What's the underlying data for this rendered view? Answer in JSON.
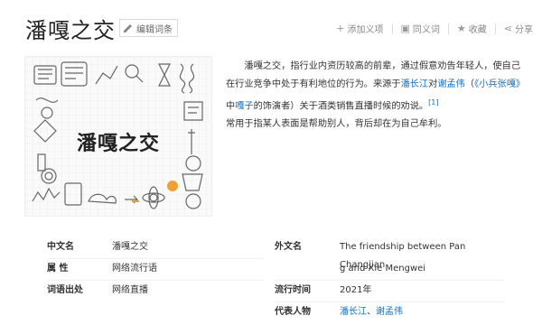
{
  "header": {
    "title": "潘嘎之交",
    "edit_label": "编辑词条",
    "actions": [
      {
        "icon": "plus",
        "label": "添加义项"
      },
      {
        "icon": "book",
        "label": "同义词"
      },
      {
        "icon": "star",
        "label": "收藏"
      },
      {
        "icon": "share",
        "label": "分享"
      }
    ]
  },
  "summary_image": {
    "caption": "潘嘎之交"
  },
  "description": {
    "p1a": "潘嘎之交，指行业内资历较高的前辈，通过假意劝告年轻人，使自己在行业竞争中处于有利地位的行为。来源于",
    "link1": "潘长江",
    "p1b": "对",
    "link2": "谢孟伟",
    "p1c": "（",
    "link3": "《小兵张嘎》",
    "p1d": "中",
    "link4": "嘎子",
    "p1e": "的饰演者）关于酒类销售直播时候的劝说。",
    "ref": "[1]",
    "p2": "常用于指某人表面是帮助别人，背后却在为自己牟利。"
  },
  "info": {
    "left": [
      {
        "label": "中文名",
        "value": "潘嘎之交"
      },
      {
        "label": "属    性",
        "value": "网络流行语"
      },
      {
        "label": "词语出处",
        "value": "网络直播"
      }
    ],
    "right": {
      "foreign_label": "外文名",
      "foreign_line1": "The friendship between Pan Changjian",
      "foreign_line2": "g and Xie Mengwei",
      "popular_label": "流行时间",
      "popular_value": "2021年",
      "rep_label": "代表人物",
      "rep_link1": "潘长江",
      "rep_sep": "、",
      "rep_link2": "谢孟伟"
    }
  }
}
